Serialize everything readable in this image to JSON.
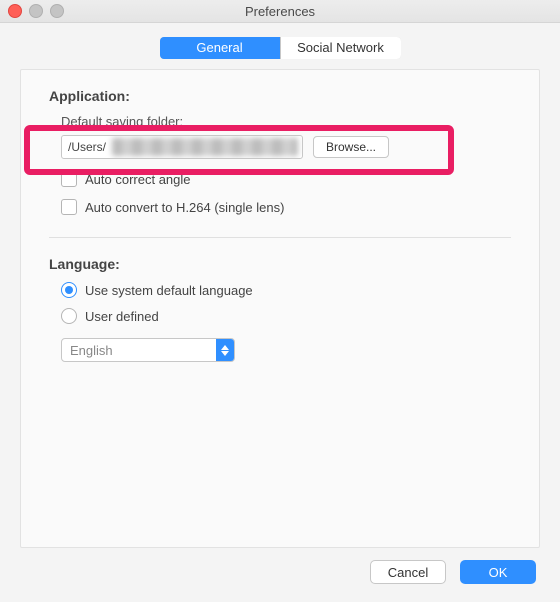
{
  "window": {
    "title": "Preferences"
  },
  "tabs": {
    "general": "General",
    "social": "Social Network",
    "selected": "general"
  },
  "application": {
    "heading": "Application:",
    "defaultFolderLabel": "Default saving folder:",
    "path": "/Users/",
    "browse": "Browse...",
    "autoCorrect": "Auto correct angle",
    "autoConvert": "Auto convert to H.264 (single lens)"
  },
  "language": {
    "heading": "Language:",
    "systemDefault": "Use system default language",
    "userDefined": "User defined",
    "selected": "system",
    "dropdownValue": "English"
  },
  "footer": {
    "cancel": "Cancel",
    "ok": "OK"
  }
}
